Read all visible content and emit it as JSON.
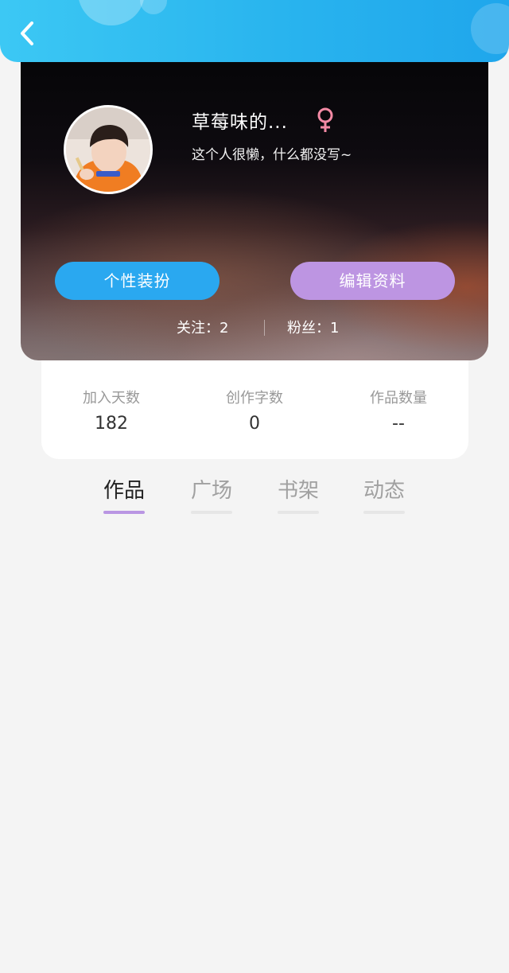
{
  "header": {
    "back_icon": "chevron-left-icon",
    "background_color": "#29b4ee"
  },
  "profile": {
    "nickname": "草莓味的...",
    "gender_icon": "female-icon",
    "gender_color": "#f48aa5",
    "bio": "这个人很懒，什么都没写~",
    "avatar": "avatar-image"
  },
  "actions": {
    "decorate_label": "个性装扮",
    "decorate_color": "#2aa8f0",
    "edit_label": "编辑资料",
    "edit_color": "#bd95e2"
  },
  "social": {
    "following_label": "关注：",
    "following_count": "2",
    "followers_label": "粉丝：",
    "followers_count": "1"
  },
  "stats": [
    {
      "label": "加入天数",
      "value": "182"
    },
    {
      "label": "创作字数",
      "value": "0"
    },
    {
      "label": "作品数量",
      "value": "--"
    }
  ],
  "tabs": [
    {
      "label": "作品",
      "active": true
    },
    {
      "label": "广场",
      "active": false
    },
    {
      "label": "书架",
      "active": false
    },
    {
      "label": "动态",
      "active": false
    }
  ],
  "colors": {
    "accent": "#b996e3",
    "page_background": "#f4f4f4"
  }
}
